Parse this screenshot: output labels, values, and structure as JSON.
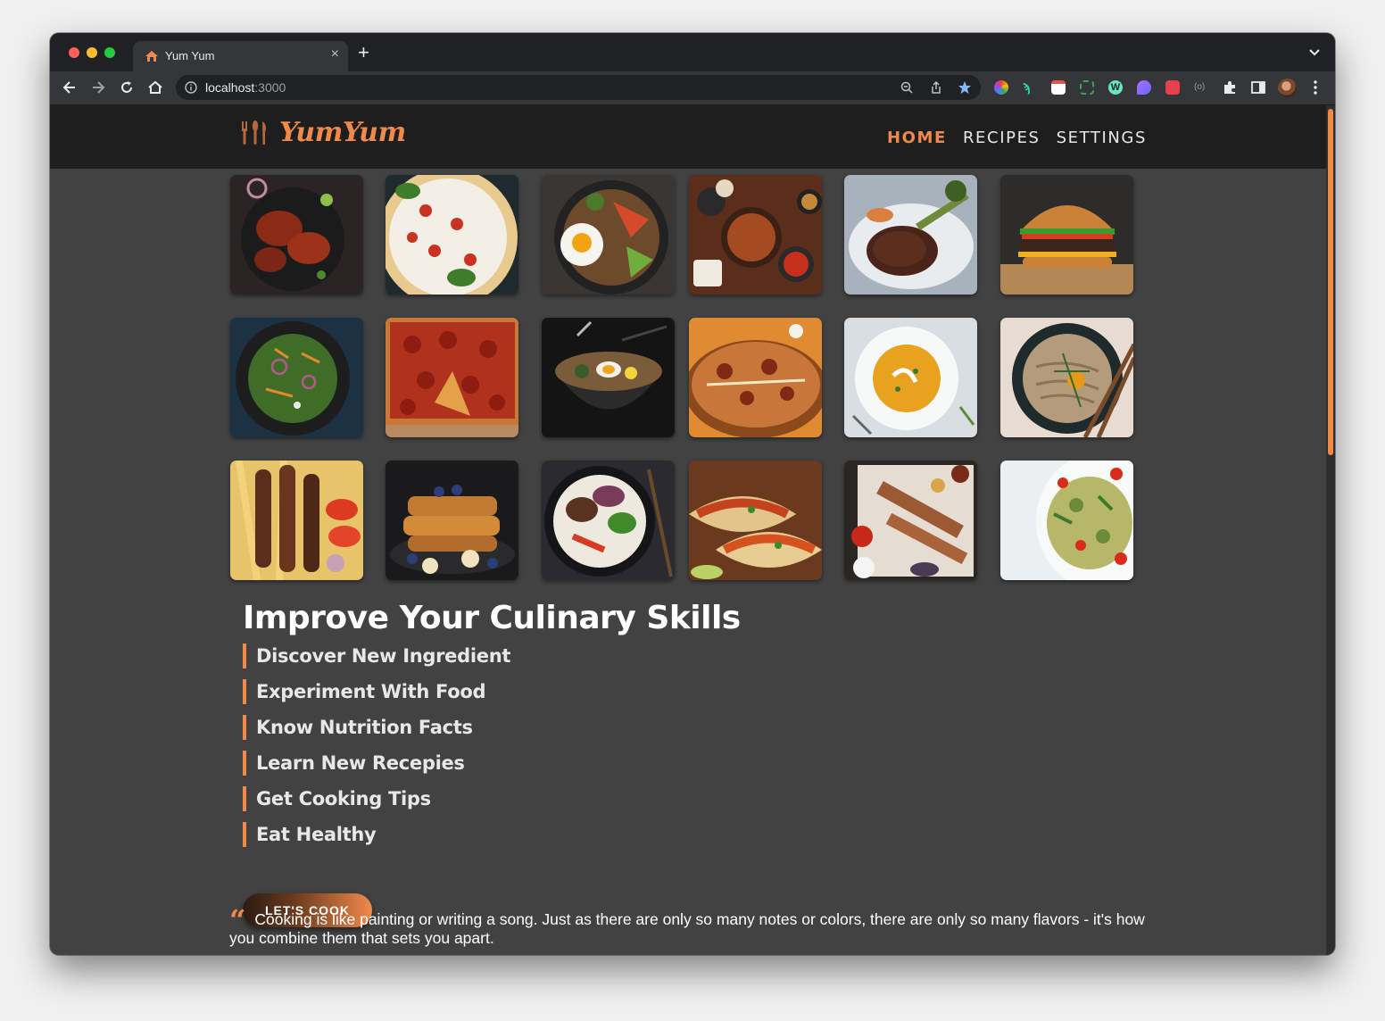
{
  "browser": {
    "tab_title": "Yum Yum",
    "url_host": "localhost",
    "url_port": ":3000"
  },
  "site": {
    "logo_text": "YumYum",
    "nav": [
      {
        "label": "HOME",
        "active": true
      },
      {
        "label": "RECIPES",
        "active": false
      },
      {
        "label": "SETTINGS",
        "active": false
      }
    ],
    "accent_color": "#f08a4b"
  },
  "gallery": [
    "tandoori-chicken-photo",
    "margherita-pizza-photo",
    "bibimbap-photo",
    "korean-table-spread-photo",
    "steak-with-broccolini-photo",
    "cheeseburger-photo",
    "green-salad-photo",
    "pepperoni-pizza-photo",
    "ramen-bowl-photo",
    "biryani-photo",
    "pumpkin-soup-photo",
    "soba-noodles-photo",
    "kebab-skewers-with-fries-photo",
    "french-toast-stack-photo",
    "rice-bowl-photo",
    "tacos-photo",
    "grilled-meat-board-photo",
    "farfalle-salad-photo"
  ],
  "main": {
    "heading": "Improve Your Culinary Skills",
    "skills": [
      "Discover New Ingredient",
      "Experiment With Food",
      "Know Nutrition Facts",
      "Learn New Recepies",
      "Get Cooking Tips",
      "Eat Healthy"
    ],
    "cta_label": "LET'S COOK",
    "quote": "Cooking is like painting or writing a song. Just as there are only so many notes or colors, there are only so many flavors - it's how you combine them that sets you apart."
  }
}
